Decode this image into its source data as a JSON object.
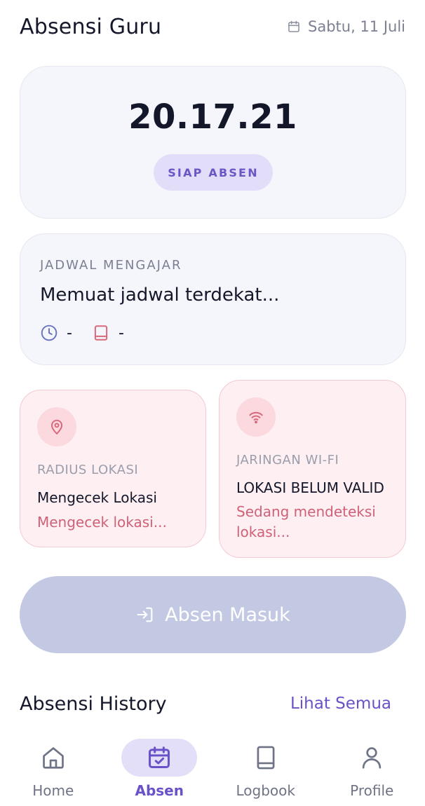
{
  "header": {
    "title": "Absensi Guru",
    "date": "Sabtu, 11 Juli",
    "date_icon": "calendar-icon"
  },
  "clock": {
    "time": "20.17.21",
    "status_badge": "SIAP ABSEN"
  },
  "schedule": {
    "label": "JADWAL MENGAJAR",
    "title": "Memuat jadwal terdekat...",
    "time_value": "-",
    "subject_value": "-"
  },
  "location_card": {
    "label": "RADIUS LOKASI",
    "value": "Mengecek Lokasi",
    "status": "Mengecek lokasi..."
  },
  "wifi_card": {
    "label": "JARINGAN WI-FI",
    "value": "LOKASI BELUM VALID",
    "status": "Sedang mendeteksi lokasi..."
  },
  "action": {
    "label": "Absen Masuk"
  },
  "history": {
    "title": "Absensi History",
    "link": "Lihat Semua"
  },
  "nav": [
    {
      "label": "Home",
      "icon": "home-icon",
      "active": false
    },
    {
      "label": "Absen",
      "icon": "calendar-check-icon",
      "active": true
    },
    {
      "label": "Logbook",
      "icon": "book-icon",
      "active": false
    },
    {
      "label": "Profile",
      "icon": "user-icon",
      "active": false
    }
  ],
  "colors": {
    "accent": "#6a51c8",
    "badge_bg": "#e2defa",
    "alert_text": "#d06176",
    "alert_bg": "#fdeff2",
    "button_disabled": "#c3c8e3"
  }
}
